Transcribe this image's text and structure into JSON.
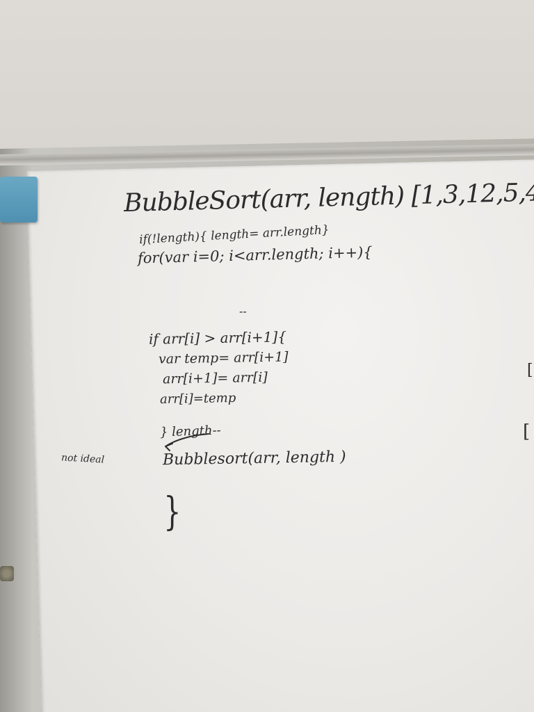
{
  "whiteboard": {
    "title_line": "BubbleSort(arr, length) [1,3,12,5,4,",
    "line_if_length": "if(!length){ length= arr.length}",
    "line_for": "for(var i=0; i<arr.length; i++){",
    "line_dash": "--",
    "line_if_compare": "if arr[i] > arr[i+1]{",
    "line_var_temp": "var temp= arr[i+1]",
    "line_assign_next": "arr[i+1]= arr[i]",
    "line_assign_current": "arr[i]=temp",
    "line_close_length": "} length--",
    "side_note": "not ideal",
    "line_recursive_call": "Bubblesort(arr, length )",
    "closing_brace": "}",
    "right_edge_mark_1": "[",
    "right_edge_mark_2": "["
  },
  "colors": {
    "ink": "#2d2a2c",
    "eraser": "#5a9bbb",
    "wall": "#dcd8d3",
    "board": "#eceae7"
  }
}
